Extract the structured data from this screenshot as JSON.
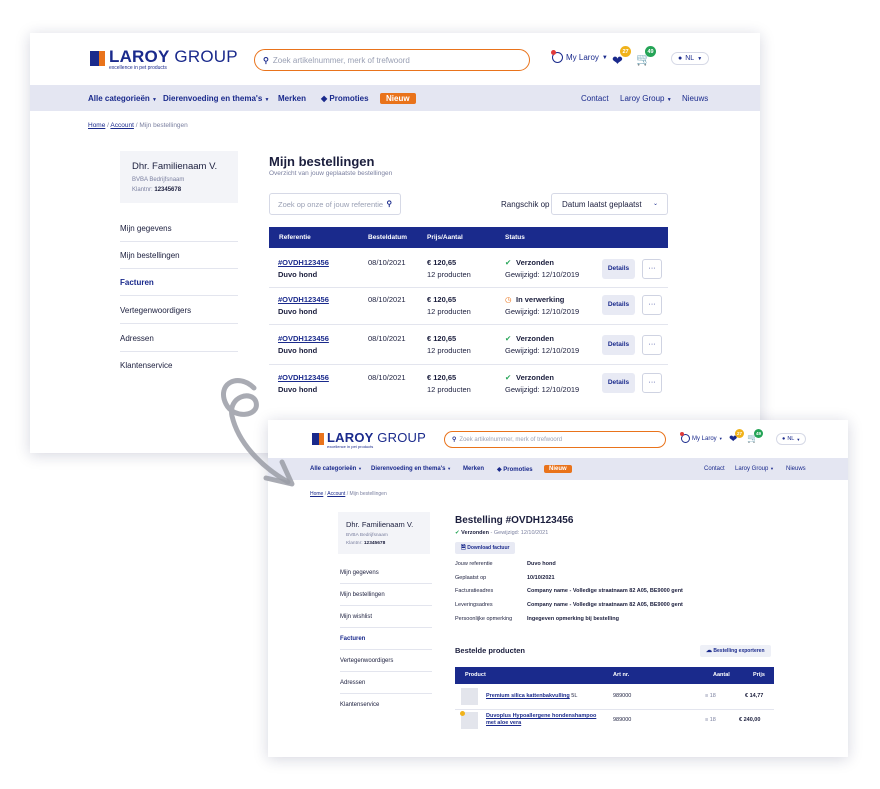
{
  "brand": {
    "name_bold": "LAROY",
    "name_light": " GROUP",
    "tagline": "excellence in pet products"
  },
  "search": {
    "placeholder": "Zoek artikelnummer, merk of trefwoord"
  },
  "topbar": {
    "account_label": "My Laroy",
    "favorites_count": "27",
    "cart_count": "49",
    "language": "NL"
  },
  "nav": {
    "categories": "Alle categorieën",
    "themes": "Dierenvoeding en thema's",
    "brands": "Merken",
    "promotions": "Promoties",
    "new": "Nieuw",
    "contact": "Contact",
    "laroy_group": "Laroy Group",
    "news": "Nieuws"
  },
  "breadcrumb": {
    "home": "Home",
    "account": "Account",
    "orders": "Mijn bestellingen",
    "separator": "/"
  },
  "customer": {
    "name": "Dhr. Familienaam V.",
    "company": "BVBA Bedrijfsnaam",
    "client_label": "Klantnr:",
    "client_number": "12345678"
  },
  "sidebar1": [
    "Mijn gegevens",
    "Mijn bestellingen",
    "Facturen",
    "Vertegenwoordigers",
    "Adressen",
    "Klantenservice"
  ],
  "sidebar2": [
    "Mijn gegevens",
    "Mijn bestellingen",
    "Mijn wishlist",
    "Facturen",
    "Vertegenwoordigers",
    "Adressen",
    "Klantenservice"
  ],
  "orders_page": {
    "title": "Mijn bestellingen",
    "subtitle": "Overzicht van jouw geplaatste bestellingen",
    "search_placeholder": "Zoek op onze of jouw referentie",
    "sort_label": "Rangschik op",
    "sort_value": "Datum laatst geplaatst",
    "columns": [
      "Referentie",
      "Besteldatum",
      "Prijs/Aantal",
      "Status"
    ],
    "details_label": "Details",
    "more_label": "···",
    "rows": [
      {
        "ref": "#OVDH123456",
        "desc": "Duvo hond",
        "date": "08/10/2021",
        "price": "€ 120,65",
        "qty": "12 producten",
        "status": "Verzonden",
        "changed": "Gewijzigd: 12/10/2019",
        "state": "ok"
      },
      {
        "ref": "#OVDH123456",
        "desc": "Duvo hond",
        "date": "08/10/2021",
        "price": "€ 120,65",
        "qty": "12 producten",
        "status": "In verwerking",
        "changed": "Gewijzigd: 12/10/2019",
        "state": "pend"
      },
      {
        "ref": "#OVDH123456",
        "desc": "Duvo hond",
        "date": "08/10/2021",
        "price": "€ 120,65",
        "qty": "12 producten",
        "status": "Verzonden",
        "changed": "Gewijzigd: 12/10/2019",
        "state": "ok"
      },
      {
        "ref": "#OVDH123456",
        "desc": "Duvo hond",
        "date": "08/10/2021",
        "price": "€ 120,65",
        "qty": "12 producten",
        "status": "Verzonden",
        "changed": "Gewijzigd: 12/10/2019",
        "state": "ok"
      }
    ]
  },
  "order_detail": {
    "title": "Bestelling #OVDH123456",
    "status": "Verzonden",
    "status_sep": "-",
    "changed": "Gewijzigd: 12/10/2021",
    "download_label": "Download factuur",
    "fields": [
      {
        "label": "Jouw referentie",
        "value": "Duvo hond"
      },
      {
        "label": "Geplaatst op",
        "value": "10/10/2021"
      },
      {
        "label": "Facturatieadres",
        "value": "Company name - Volledige straatnaam 82 A05, BE9000 gent"
      },
      {
        "label": "Leveringsadres",
        "value": "Company name - Volledige straatnaam 82 A05, BE9000 gent"
      },
      {
        "label": "Persoonlijke opmerking",
        "value": "Ingegeven opmerking bij bestelling"
      }
    ],
    "products_title": "Bestelde producten",
    "export_label": "Bestelling exporteren",
    "columns": [
      "Product",
      "Art nr.",
      "Aantal",
      "Prijs"
    ],
    "products": [
      {
        "name": "Premium silica kattenbakvulling",
        "suffix": " 5L",
        "art": "989000",
        "qty": "18",
        "price": "€ 14,77"
      },
      {
        "name": "Duvoplus Hypoallergene hondenshampoo met aloe vera",
        "suffix": "",
        "art": "989000",
        "qty": "18",
        "price": "€ 240,00"
      }
    ]
  },
  "colors": {
    "brand_blue": "#1a2a8c",
    "accent_orange": "#e9731b",
    "success_green": "#24a456",
    "nav_background": "#e4e6f2"
  },
  "icons": {
    "search": "search-icon",
    "account": "user-icon",
    "favorites": "heart-icon",
    "cart": "cart-icon",
    "globe": "globe-icon",
    "promotion": "tag-icon",
    "status_ok": "check-circle-icon",
    "status_pending": "clock-icon",
    "download": "file-download-icon",
    "export": "cloud-upload-icon"
  }
}
